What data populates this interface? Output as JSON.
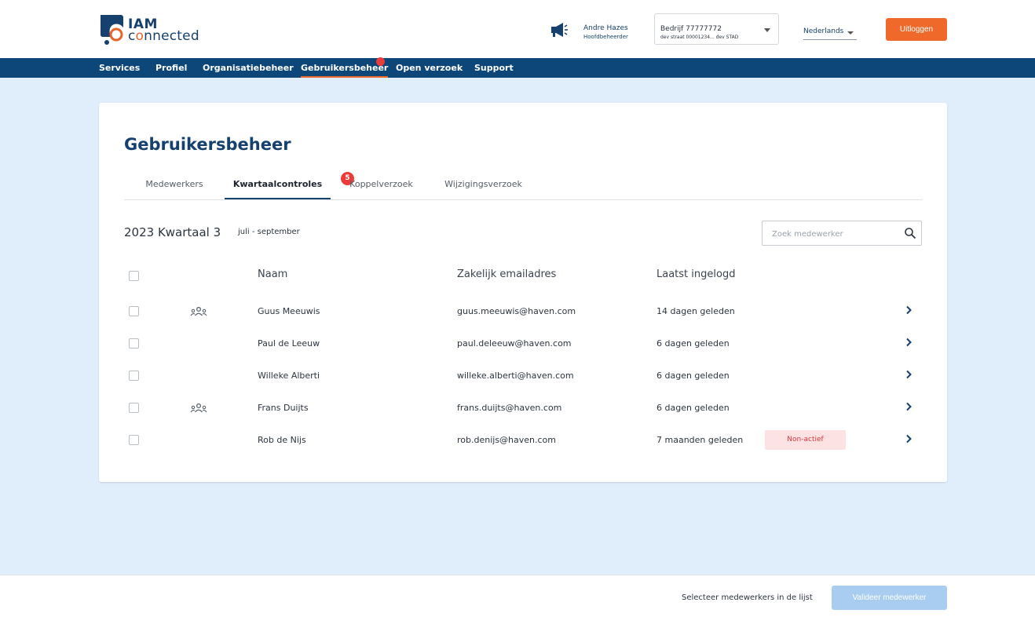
{
  "header": {
    "logo": {
      "line1": "IAM",
      "line2_prefix": "c",
      "line2_o": "o",
      "line2_suffix": "nnected"
    },
    "user": {
      "name": "Andre Hazes",
      "role": "Hoofdbeheerder"
    },
    "company": {
      "name": "Bedrijf 77777772",
      "address": "dev straat 00001234... dev STAD"
    },
    "language": "Nederlands",
    "logout_label": "Uitloggen"
  },
  "nav": {
    "items": [
      {
        "label": "Services"
      },
      {
        "label": "Profiel"
      },
      {
        "label": "Organisatiebeheer"
      },
      {
        "label": "Gebruikersbeheer",
        "active": true
      },
      {
        "label": "Open verzoek"
      },
      {
        "label": "Support"
      }
    ]
  },
  "main": {
    "title": "Gebruikersbeheer",
    "tabs": [
      {
        "label": "Medewerkers"
      },
      {
        "label": "Kwartaalcontroles",
        "active": true,
        "badge": "5"
      },
      {
        "label": "Koppelverzoek"
      },
      {
        "label": "Wijzigingsverzoek"
      }
    ],
    "period": {
      "quarter": "2023 Kwartaal 3",
      "range": "juli - september"
    },
    "search_placeholder": "Zoek medewerker",
    "table": {
      "columns": [
        "Naam",
        "Zakelijk emailadres",
        "Laatst ingelogd"
      ],
      "rows": [
        {
          "name": "Guus Meeuwis",
          "email": "guus.meeuwis@haven.com",
          "last_login": "14 dagen geleden",
          "group_icon": true,
          "status": ""
        },
        {
          "name": "Paul de Leeuw",
          "email": "paul.deleeuw@haven.com",
          "last_login": "6 dagen geleden",
          "group_icon": false,
          "status": ""
        },
        {
          "name": "Willeke Alberti",
          "email": "willeke.alberti@haven.com",
          "last_login": "6 dagen geleden",
          "group_icon": false,
          "status": ""
        },
        {
          "name": "Frans Duijts",
          "email": "frans.duijts@haven.com",
          "last_login": "6 dagen geleden",
          "group_icon": true,
          "status": ""
        },
        {
          "name": "Rob de Nijs",
          "email": "rob.denijs@haven.com",
          "last_login": "7 maanden geleden",
          "group_icon": false,
          "status": "Non-actief"
        }
      ]
    }
  },
  "footer": {
    "hint": "Selecteer medewerkers in de lijst",
    "validate_label": "Valideer medewerker"
  },
  "colors": {
    "brand_navy": "#0d477a",
    "accent_orange": "#ef6a2a",
    "badge_red": "#ec3b3b",
    "page_bg": "#e0eefc",
    "disabled_button": "#a8cdf0"
  }
}
